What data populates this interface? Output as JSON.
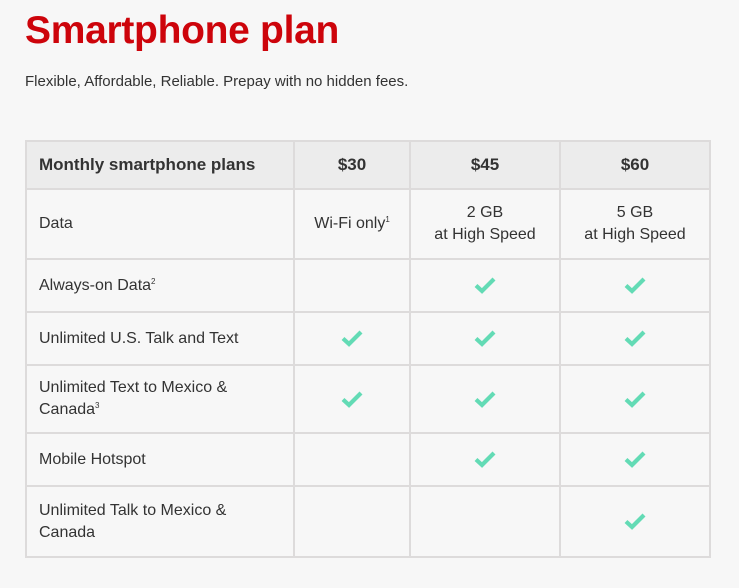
{
  "page": {
    "title": "Smartphone plan",
    "subtitle": "Flexible, Affordable, Reliable. Prepay with no hidden fees."
  },
  "colors": {
    "title": "#cd040b",
    "check": "#63dbb5",
    "header_bg": "#ececec",
    "border": "#dddbdb",
    "page_bg": "#f7f7f7"
  },
  "table": {
    "header": {
      "label": "Monthly smartphone plans",
      "plans": [
        "$30",
        "$45",
        "$60"
      ]
    },
    "rows": [
      {
        "feature": "Data",
        "footnote": "",
        "values": [
          {
            "type": "text",
            "line1": "Wi-Fi only",
            "line2": "",
            "footnote": "1"
          },
          {
            "type": "text",
            "line1": "2 GB",
            "line2": "at High Speed",
            "footnote": ""
          },
          {
            "type": "text",
            "line1": "5 GB",
            "line2": "at High Speed",
            "footnote": ""
          }
        ]
      },
      {
        "feature": "Always-on Data",
        "footnote": "2",
        "values": [
          {
            "type": "empty"
          },
          {
            "type": "check",
            "icon": "checkmark-icon"
          },
          {
            "type": "check",
            "icon": "checkmark-icon"
          }
        ]
      },
      {
        "feature": "Unlimited U.S. Talk and Text",
        "footnote": "",
        "values": [
          {
            "type": "check",
            "icon": "checkmark-icon"
          },
          {
            "type": "check",
            "icon": "checkmark-icon"
          },
          {
            "type": "check",
            "icon": "checkmark-icon"
          }
        ]
      },
      {
        "feature": "Unlimited Text to Mexico & Canada",
        "footnote": "3",
        "values": [
          {
            "type": "check",
            "icon": "checkmark-icon"
          },
          {
            "type": "check",
            "icon": "checkmark-icon"
          },
          {
            "type": "check",
            "icon": "checkmark-icon"
          }
        ]
      },
      {
        "feature": "Mobile Hotspot",
        "footnote": "",
        "values": [
          {
            "type": "empty"
          },
          {
            "type": "check",
            "icon": "checkmark-icon"
          },
          {
            "type": "check",
            "icon": "checkmark-icon"
          }
        ]
      },
      {
        "feature": "Unlimited Talk to Mexico & Canada",
        "footnote": "",
        "values": [
          {
            "type": "empty"
          },
          {
            "type": "empty"
          },
          {
            "type": "check",
            "icon": "checkmark-icon"
          }
        ]
      }
    ]
  }
}
